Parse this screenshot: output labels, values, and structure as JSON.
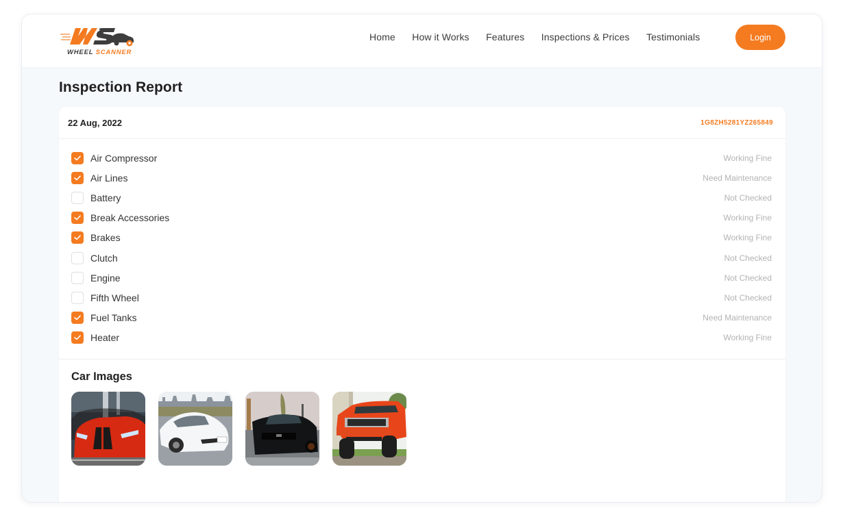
{
  "brand": {
    "name_part1": "WHEEL",
    "name_part2": "SCANNER",
    "monogram": "WS",
    "accent_color": "#f47b20"
  },
  "nav": {
    "links": [
      "Home",
      "How it Works",
      "Features",
      "Inspections & Prices",
      "Testimonials"
    ],
    "login_label": "Login"
  },
  "page": {
    "title": "Inspection Report"
  },
  "report": {
    "date": "22 Aug, 2022",
    "vin": "1G8ZH5281YZ265849",
    "items": [
      {
        "label": "Air Compressor",
        "checked": true,
        "status": "Working Fine"
      },
      {
        "label": "Air Lines",
        "checked": true,
        "status": "Need Maintenance"
      },
      {
        "label": "Battery",
        "checked": false,
        "status": "Not Checked"
      },
      {
        "label": "Break Accessories",
        "checked": true,
        "status": "Working Fine"
      },
      {
        "label": "Brakes",
        "checked": true,
        "status": "Working Fine"
      },
      {
        "label": "Clutch",
        "checked": false,
        "status": "Not Checked"
      },
      {
        "label": "Engine",
        "checked": false,
        "status": "Not Checked"
      },
      {
        "label": "Fifth Wheel",
        "checked": false,
        "status": "Not Checked"
      },
      {
        "label": "Fuel Tanks",
        "checked": true,
        "status": "Need Maintenance"
      },
      {
        "label": "Heater",
        "checked": true,
        "status": "Working Fine"
      }
    ]
  },
  "car_images": {
    "title": "Car Images",
    "images": [
      {
        "alt": "Red sports sedan front view"
      },
      {
        "alt": "White sports car side view"
      },
      {
        "alt": "Black muscle car front view"
      },
      {
        "alt": "Orange lifted pickup truck"
      }
    ]
  }
}
